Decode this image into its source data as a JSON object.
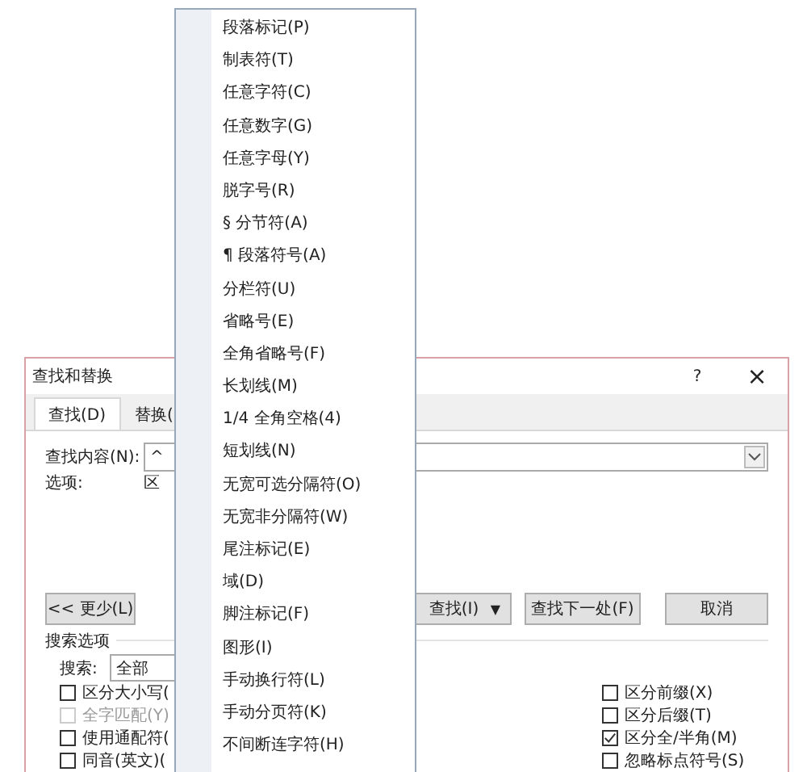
{
  "dialog": {
    "title": "查找和替换",
    "help_button": "?",
    "close_button": "×",
    "tabs": [
      {
        "label": "查找(D)",
        "selected": true
      },
      {
        "label": "替换(",
        "selected": false
      }
    ],
    "find_label": "查找内容(N):",
    "find_value": "^",
    "options_label": "选项:",
    "options_value": "区",
    "buttons": [
      {
        "label": "<< 更少(L)",
        "kind": "plain"
      },
      {
        "label": "查找(I)",
        "kind": "split",
        "caret": "▼"
      },
      {
        "label": "查找下一处(F)",
        "kind": "plain"
      },
      {
        "label": "取消",
        "kind": "plain"
      }
    ],
    "search_options_title": "搜索选项",
    "search_label": "搜索:",
    "search_value": "全部",
    "left_options": [
      {
        "label": "区分大小写(",
        "checked": false,
        "disabled": false
      },
      {
        "label": "全字匹配(Y)",
        "checked": false,
        "disabled": true
      },
      {
        "label": "使用通配符(",
        "checked": false,
        "disabled": false
      },
      {
        "label": "同音(英文)(",
        "checked": false,
        "disabled": false
      }
    ],
    "right_options": [
      {
        "label": "区分前缀(X)",
        "checked": false,
        "disabled": false
      },
      {
        "label": "区分后缀(T)",
        "checked": false,
        "disabled": false
      },
      {
        "label": "区分全/半角(M)",
        "checked": true,
        "disabled": false
      },
      {
        "label": "忽略标点符号(S)",
        "checked": false,
        "disabled": false
      }
    ]
  },
  "menu": {
    "items": [
      "段落标记(P)",
      "制表符(T)",
      "任意字符(C)",
      "任意数字(G)",
      "任意字母(Y)",
      "脱字号(R)",
      "§ 分节符(A)",
      "¶ 段落符号(A)",
      "分栏符(U)",
      "省略号(E)",
      "全角省略号(F)",
      "长划线(M)",
      "1/4 全角空格(4)",
      "短划线(N)",
      "无宽可选分隔符(O)",
      "无宽非分隔符(W)",
      "尾注标记(E)",
      "域(D)",
      "脚注标记(F)",
      "图形(I)",
      "手动换行符(L)",
      "手动分页符(K)",
      "不间断连字符(H)"
    ]
  }
}
